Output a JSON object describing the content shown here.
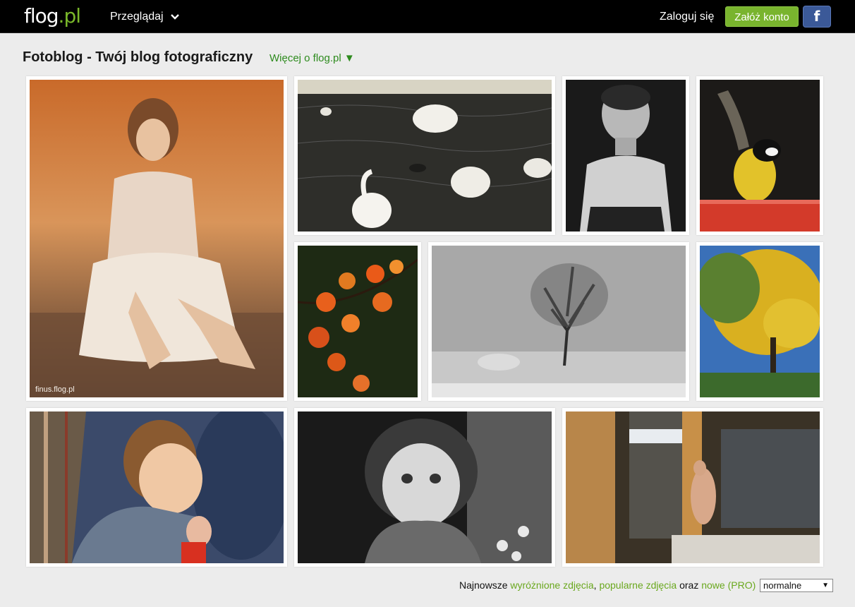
{
  "nav": {
    "logo_main": "flog",
    "logo_tld": ".pl",
    "browse_label": "Przeglądaj",
    "login_label": "Zaloguj się",
    "signup_label": "Załóż konto",
    "facebook_label": "f"
  },
  "header": {
    "title": "Fotoblog - Twój blog fotograficzny",
    "more_link": "Więcej o flog.pl ▼"
  },
  "photos": {
    "p1_watermark": "finus.flog.pl"
  },
  "footer": {
    "prefix": "Najnowsze",
    "link_featured": "wyróżnione zdjęcia",
    "comma": ",",
    "link_popular": "popularne zdjęcia",
    "and": "oraz",
    "link_new": "nowe (PRO)",
    "select_value": "normalne"
  },
  "colors": {
    "accent_green": "#79b42e",
    "link_green": "#2e8b1e",
    "facebook_blue": "#3b5998"
  }
}
